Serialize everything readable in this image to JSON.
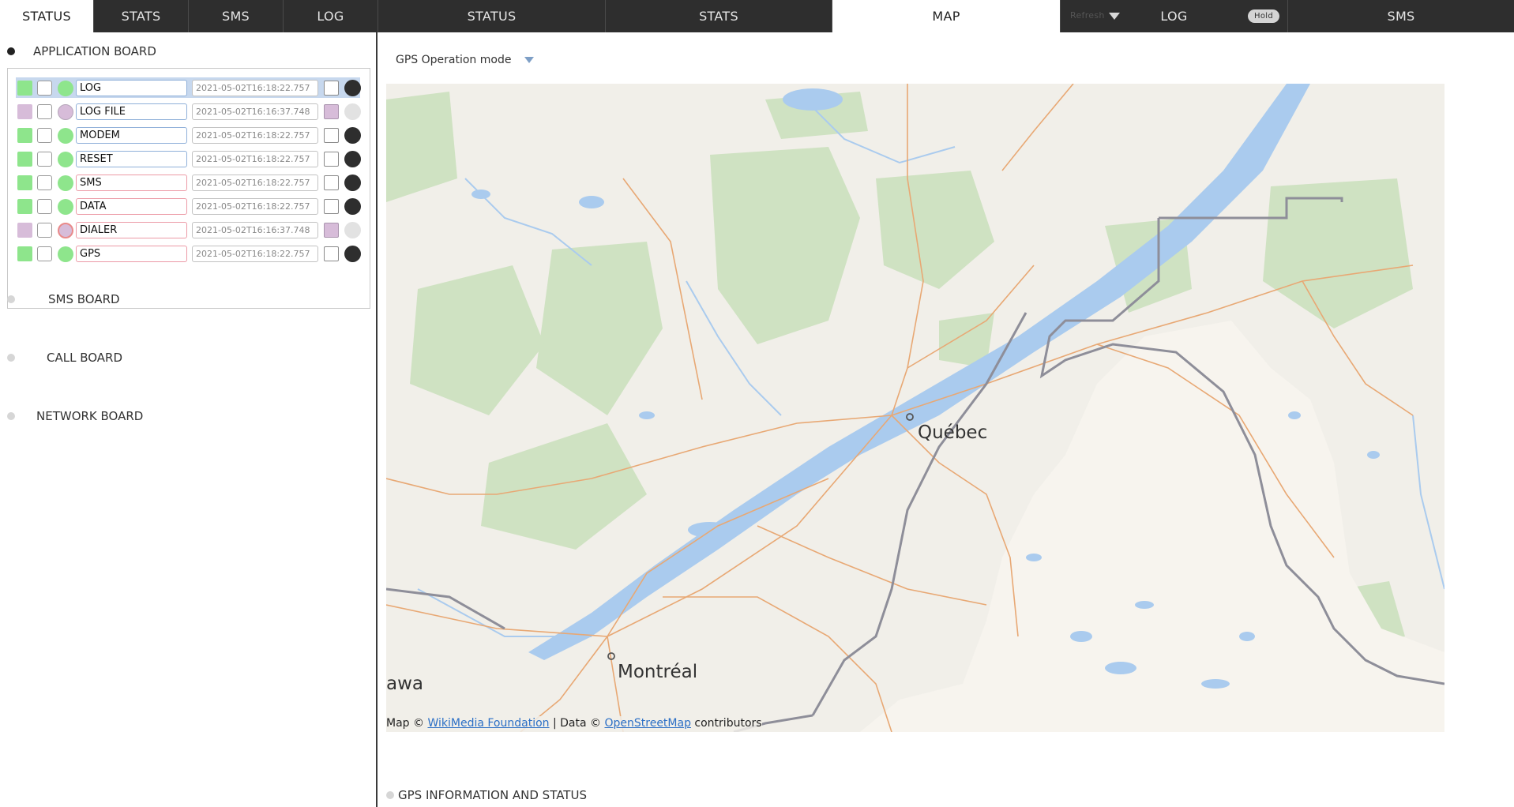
{
  "tabs": {
    "left": [
      {
        "label": "STATUS",
        "active": true
      },
      {
        "label": "STATS",
        "active": false
      },
      {
        "label": "SMS",
        "active": false
      },
      {
        "label": "LOG",
        "active": false
      }
    ],
    "right": [
      {
        "label": "STATUS",
        "active": false
      },
      {
        "label": "STATS",
        "active": false
      },
      {
        "label": "MAP",
        "active": true
      },
      {
        "label": "LOG",
        "active": false
      },
      {
        "label": "SMS",
        "active": false
      }
    ],
    "refresh_label": "Refresh",
    "hold_label": "Hold"
  },
  "left_panel": {
    "application_board": {
      "title": "APPLICATION BOARD",
      "rows": [
        {
          "name": "LOG",
          "timestamp": "2021-05-02T16:18:22.757",
          "status": "active",
          "selected": true
        },
        {
          "name": "LOG FILE",
          "timestamp": "2021-05-02T16:16:37.748",
          "status": "inactive",
          "selected": false
        },
        {
          "name": "MODEM",
          "timestamp": "2021-05-02T16:18:22.757",
          "status": "active",
          "selected": false
        },
        {
          "name": "RESET",
          "timestamp": "2021-05-02T16:18:22.757",
          "status": "active",
          "selected": false
        },
        {
          "name": "SMS",
          "timestamp": "2021-05-02T16:18:22.757",
          "status": "active",
          "selected": false
        },
        {
          "name": "DATA",
          "timestamp": "2021-05-02T16:18:22.757",
          "status": "active",
          "selected": false
        },
        {
          "name": "DIALER",
          "timestamp": "2021-05-02T16:16:37.748",
          "status": "error",
          "selected": false
        },
        {
          "name": "GPS",
          "timestamp": "2021-05-02T16:18:22.757",
          "status": "active",
          "selected": false
        }
      ]
    },
    "sms_board": {
      "title": "SMS BOARD"
    },
    "call_board": {
      "title": "CALL BOARD"
    },
    "network_board": {
      "title": "NETWORK BOARD"
    }
  },
  "main": {
    "gps_mode_label": "GPS Operation mode",
    "map": {
      "labels": {
        "quebec": "Québec",
        "montreal": "Montréal",
        "ottawa_partial": "awa"
      },
      "attribution": {
        "prefix": "Map ©",
        "link1": "WikiMedia Foundation",
        "middle": "| Data ©",
        "link2": "OpenStreetMap",
        "suffix": "contributors"
      }
    },
    "gps_info_title": "GPS INFORMATION AND STATUS"
  },
  "colors": {
    "tabbar": "#2e2e2e",
    "status_green": "#8ee58c",
    "status_violet": "#d7bcd9",
    "water": "#aacbee",
    "forest": "#cfe2c2",
    "road": "#e8a874"
  }
}
